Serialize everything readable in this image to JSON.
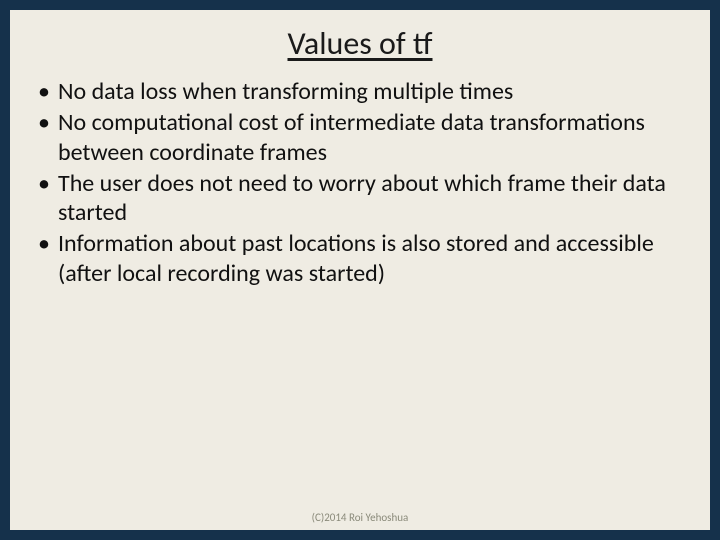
{
  "slide": {
    "title": "Values of tf",
    "bullets": [
      "No data loss when transforming multiple times",
      "No computational cost of intermediate data transformations between coordinate frames",
      "The user does not need to worry about which frame their data started",
      "Information about past locations is also stored and accessible (after local recording was started)"
    ],
    "footer": "(C)2014 Roi Yehoshua"
  }
}
